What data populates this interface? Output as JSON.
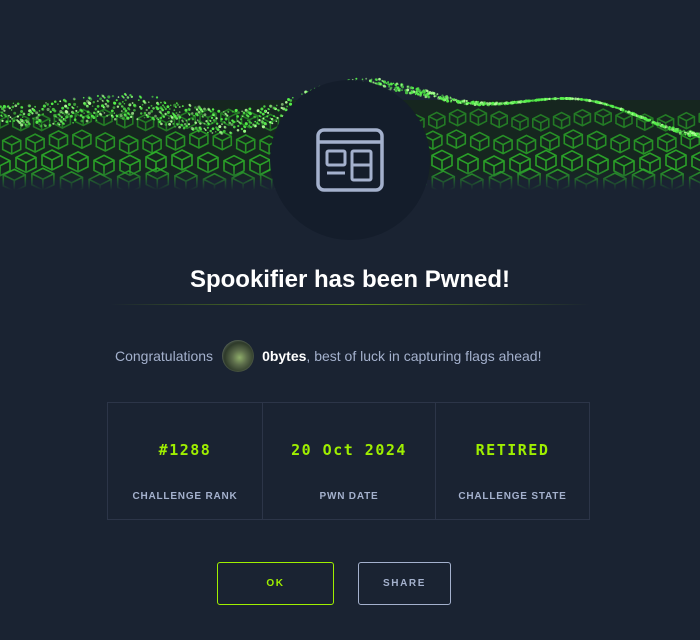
{
  "modal": {
    "title": "Spookifier has been Pwned!",
    "congrats_prefix": "Congratulations",
    "username": "0bytes",
    "congrats_suffix": ", best of luck in capturing flags ahead!"
  },
  "stats": [
    {
      "value": "#1288",
      "label": "CHALLENGE RANK"
    },
    {
      "value": "20 Oct 2024",
      "label": "PWN DATE"
    },
    {
      "value": "RETIRED",
      "label": "CHALLENGE STATE"
    }
  ],
  "buttons": {
    "ok": "OK",
    "share": "SHARE"
  },
  "icons": {
    "challenge_category": "web-window-icon",
    "banner": "cube-wave-banner"
  },
  "colors": {
    "background": "#1a2332",
    "accent": "#9fef00",
    "muted_text": "#a4b1cd",
    "circle": "#141d2b"
  }
}
